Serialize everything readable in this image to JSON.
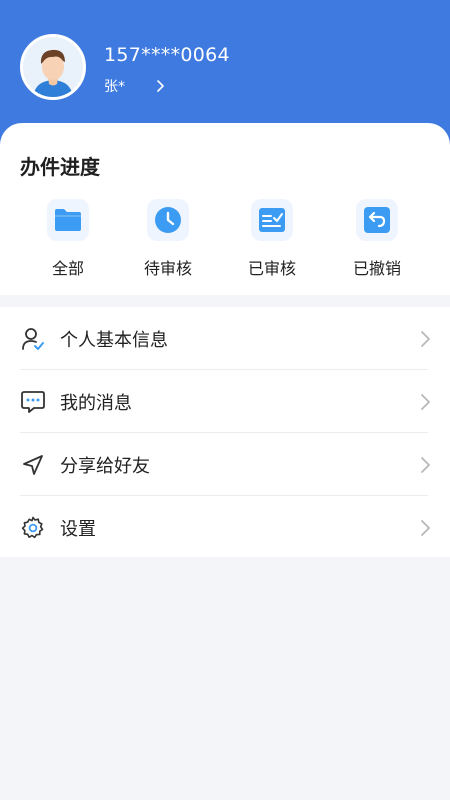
{
  "user": {
    "phone": "157****0064",
    "name": "张*"
  },
  "progress": {
    "title": "办件进度",
    "items": [
      {
        "label": "全部",
        "icon": "folder-icon"
      },
      {
        "label": "待审核",
        "icon": "clock-icon"
      },
      {
        "label": "已审核",
        "icon": "reviewed-document-icon"
      },
      {
        "label": "已撤销",
        "icon": "undo-icon"
      }
    ]
  },
  "menu": {
    "items": [
      {
        "label": "个人基本信息",
        "icon": "user-check-icon"
      },
      {
        "label": "我的消息",
        "icon": "message-icon"
      },
      {
        "label": "分享给好友",
        "icon": "send-icon"
      },
      {
        "label": "设置",
        "icon": "gear-icon"
      }
    ]
  },
  "colors": {
    "header": "#3f7ae0",
    "icon_blue": "#3c9cf3",
    "background": "#f4f5f9"
  }
}
